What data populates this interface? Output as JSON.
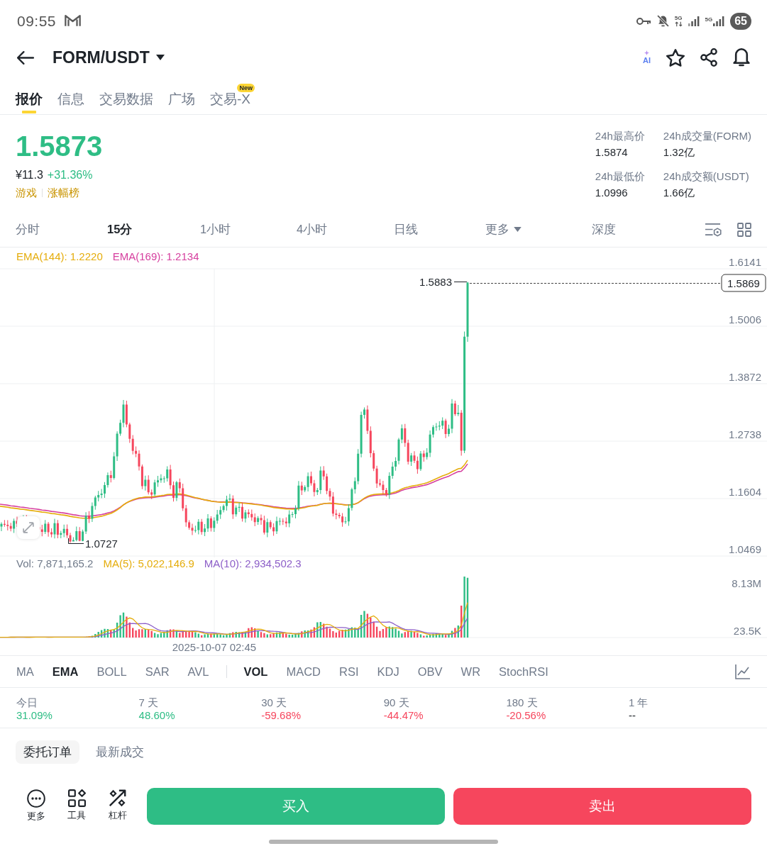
{
  "status_bar": {
    "time": "09:55",
    "network_labels": [
      "5G",
      "5G"
    ],
    "battery": "65"
  },
  "header": {
    "pair": "FORM/USDT",
    "ai_label": "AI"
  },
  "tabs": [
    {
      "label": "报价",
      "selected": true
    },
    {
      "label": "信息",
      "selected": false
    },
    {
      "label": "交易数据",
      "selected": false
    },
    {
      "label": "广场",
      "selected": false
    },
    {
      "label": "交易-X",
      "selected": false,
      "badge": "New"
    }
  ],
  "ticker": {
    "price": "1.5873",
    "rising": true,
    "fiat_price": "¥11.3",
    "change": "+31.36%",
    "tags": [
      "游戏",
      "涨幅榜"
    ],
    "stats": [
      {
        "label": "24h最高价",
        "value": "1.5874"
      },
      {
        "label": "24h成交量(FORM)",
        "value": "1.32亿"
      },
      {
        "label": "24h最低价",
        "value": "1.0996"
      },
      {
        "label": "24h成交额(USDT)",
        "value": "1.66亿"
      }
    ]
  },
  "timeframes": [
    {
      "label": "分时",
      "selected": false,
      "dropdown": false
    },
    {
      "label": "15分",
      "selected": true,
      "dropdown": false
    },
    {
      "label": "1小时",
      "selected": false,
      "dropdown": false
    },
    {
      "label": "4小时",
      "selected": false,
      "dropdown": false
    },
    {
      "label": "日线",
      "selected": false,
      "dropdown": false
    },
    {
      "label": "更多",
      "selected": false,
      "dropdown": true
    },
    {
      "label": "深度",
      "selected": false,
      "dropdown": false
    }
  ],
  "price_chart": {
    "legend": [
      {
        "label": "EMA(144): 1.2220",
        "color": "#e5ad0c"
      },
      {
        "label": "EMA(169): 1.2134",
        "color": "#d6409f"
      }
    ],
    "y_axis_labels": [
      "1.6141",
      "1.5006",
      "1.3872",
      "1.2738",
      "1.1604",
      "1.0469"
    ],
    "high_label": "1.5883",
    "low_label": "1.0727",
    "last_price": "1.5869"
  },
  "volume_chart": {
    "legend": [
      {
        "label": "Vol: 7,871,165.2",
        "color": "#707a8a"
      },
      {
        "label": "MA(5): 5,022,146.9",
        "color": "#e5ad0c"
      },
      {
        "label": "MA(10): 2,934,502.3",
        "color": "#8d5fc8"
      }
    ],
    "y_axis_labels": [
      "8.13M",
      "23.5K"
    ],
    "time_label": "2025-10-07 02:45"
  },
  "indicators": {
    "main": [
      {
        "label": "MA",
        "selected": false
      },
      {
        "label": "EMA",
        "selected": true
      },
      {
        "label": "BOLL",
        "selected": false
      },
      {
        "label": "SAR",
        "selected": false
      },
      {
        "label": "AVL",
        "selected": false
      }
    ],
    "sub": [
      {
        "label": "VOL",
        "selected": true
      },
      {
        "label": "MACD",
        "selected": false
      },
      {
        "label": "RSI",
        "selected": false
      },
      {
        "label": "KDJ",
        "selected": false
      },
      {
        "label": "OBV",
        "selected": false
      },
      {
        "label": "WR",
        "selected": false
      },
      {
        "label": "StochRSI",
        "selected": false
      }
    ]
  },
  "performance": [
    {
      "period": "今日",
      "value": "31.09%",
      "kind": "gain"
    },
    {
      "period": "7 天",
      "value": "48.60%",
      "kind": "gain"
    },
    {
      "period": "30 天",
      "value": "-59.68%",
      "kind": "loss"
    },
    {
      "period": "90 天",
      "value": "-44.47%",
      "kind": "loss"
    },
    {
      "period": "180 天",
      "value": "-20.56%",
      "kind": "loss"
    },
    {
      "period": "1 年",
      "value": "--",
      "kind": "none"
    }
  ],
  "order_tabs": [
    {
      "label": "委托订单",
      "selected": true
    },
    {
      "label": "最新成交",
      "selected": false
    }
  ],
  "bottom_bar": {
    "tools": [
      {
        "label": "更多",
        "kind": "more"
      },
      {
        "label": "工具",
        "kind": "tools"
      },
      {
        "label": "杠杆",
        "kind": "leverage"
      }
    ],
    "buy": "买入",
    "sell": "卖出"
  }
}
